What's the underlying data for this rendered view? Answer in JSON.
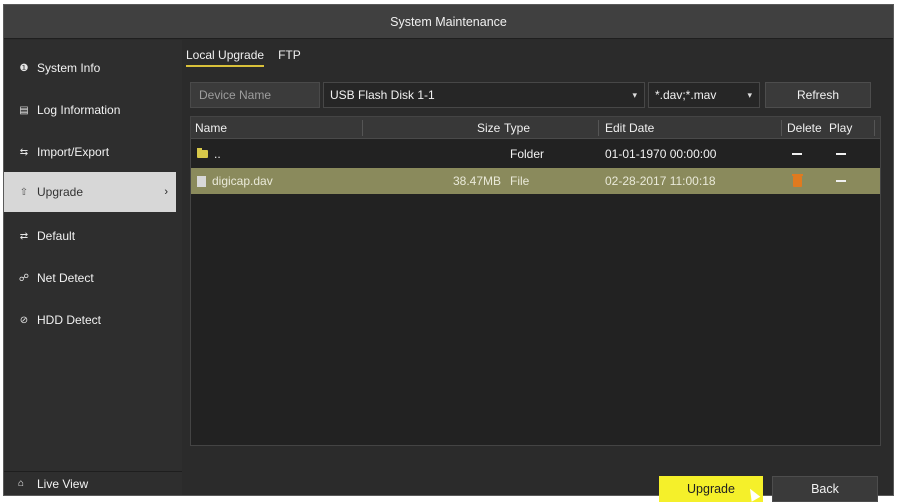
{
  "window": {
    "title": "System Maintenance"
  },
  "sidebar": {
    "items": [
      {
        "label": "System Info",
        "icon": "info-icon"
      },
      {
        "label": "Log Information",
        "icon": "log-icon"
      },
      {
        "label": "Import/Export",
        "icon": "import-export-icon"
      },
      {
        "label": "Upgrade",
        "icon": "upgrade-icon",
        "active": true
      },
      {
        "label": "Default",
        "icon": "default-icon"
      },
      {
        "label": "Net Detect",
        "icon": "net-detect-icon"
      },
      {
        "label": "HDD Detect",
        "icon": "hdd-detect-icon"
      }
    ],
    "live_view": "Live View"
  },
  "tabs": [
    {
      "label": "Local Upgrade",
      "active": true
    },
    {
      "label": "FTP",
      "active": false
    }
  ],
  "controls": {
    "device_label": "Device Name",
    "device_value": "USB Flash Disk 1-1",
    "filter_value": "*.dav;*.mav",
    "refresh_label": "Refresh"
  },
  "table": {
    "headers": {
      "name": "Name",
      "size": "Size",
      "type": "Type",
      "edit_date": "Edit Date",
      "delete": "Delete",
      "play": "Play"
    },
    "rows": [
      {
        "name": "..",
        "size": "",
        "type": "Folder",
        "edit_date": "01-01-1970 00:00:00",
        "kind": "folder",
        "selected": false
      },
      {
        "name": "digicap.dav",
        "size": "38.47MB",
        "type": "File",
        "edit_date": "02-28-2017 11:00:18",
        "kind": "file",
        "selected": true
      }
    ]
  },
  "buttons": {
    "upgrade": "Upgrade",
    "back": "Back"
  },
  "colors": {
    "upgrade_button": "#f5f02a",
    "selected_row": "#8a8a5c",
    "active_tab_underline": "#d9c13a",
    "delete_icon": "#e07a1f"
  }
}
